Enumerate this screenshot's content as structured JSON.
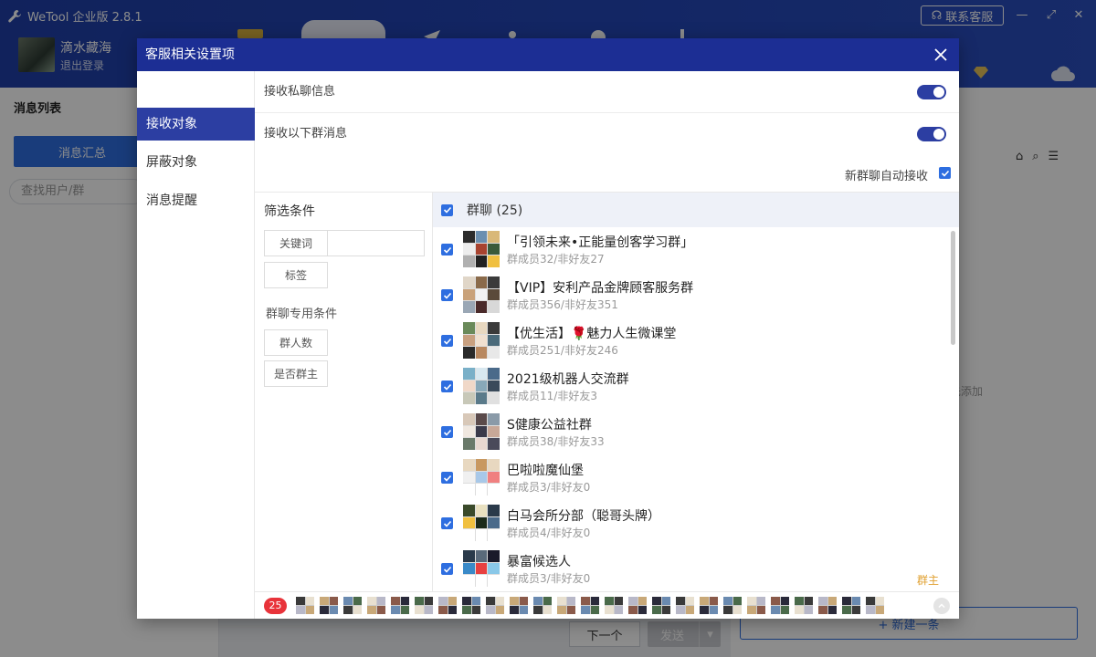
{
  "app": {
    "title": "WeTool 企业版 2.8.1",
    "service_btn": "联系客服"
  },
  "user": {
    "name": "滴水藏海",
    "logout": "退出登录"
  },
  "left_panel": {
    "title": "消息列表",
    "summary_btn": "消息汇总",
    "search_placeholder": "查找用户/群"
  },
  "middle": {
    "next_btn": "下一个",
    "send_btn": "发送"
  },
  "right_panel": {
    "hint": "先添加",
    "new_btn": "+ 新建一条"
  },
  "dialog": {
    "title": "客服相关设置项",
    "nav": [
      "接收对象",
      "屏蔽对象",
      "消息提醒"
    ],
    "options": {
      "private_label": "接收私聊信息",
      "group_label": "接收以下群消息",
      "auto_recv": "新群聊自动接收"
    },
    "filters": {
      "title": "筛选条件",
      "keyword": "关键词",
      "tag": "标签",
      "group_cond": "群聊专用条件",
      "member_count": "群人数",
      "is_owner": "是否群主"
    },
    "list": {
      "header": "群聊 (25)",
      "groups": [
        {
          "name": "「引领未来•正能量创客学习群」",
          "sub": "群成员32/非好友27",
          "owner": ""
        },
        {
          "name": "【VIP】安利产品金牌顾客服务群",
          "sub": "群成员356/非好友351",
          "owner": ""
        },
        {
          "name": "【优生活】🌹魅力人生微课堂",
          "sub": "群成员251/非好友246",
          "owner": ""
        },
        {
          "name": "2021级机器人交流群",
          "sub": "群成员11/非好友3",
          "owner": ""
        },
        {
          "name": "S健康公益社群",
          "sub": "群成员38/非好友33",
          "owner": ""
        },
        {
          "name": "巴啦啦魔仙堡",
          "sub": "群成员3/非好友0",
          "owner": ""
        },
        {
          "name": "白马会所分部（聪哥头牌）",
          "sub": "群成员4/非好友0",
          "owner": ""
        },
        {
          "name": "暴富候选人",
          "sub": "群成员3/非好友0",
          "owner": "群主"
        }
      ]
    },
    "selected_count": "25"
  },
  "colors": {
    "brand": "#1c2e94",
    "accent": "#2e6ee0",
    "badge": "#e8333a"
  }
}
